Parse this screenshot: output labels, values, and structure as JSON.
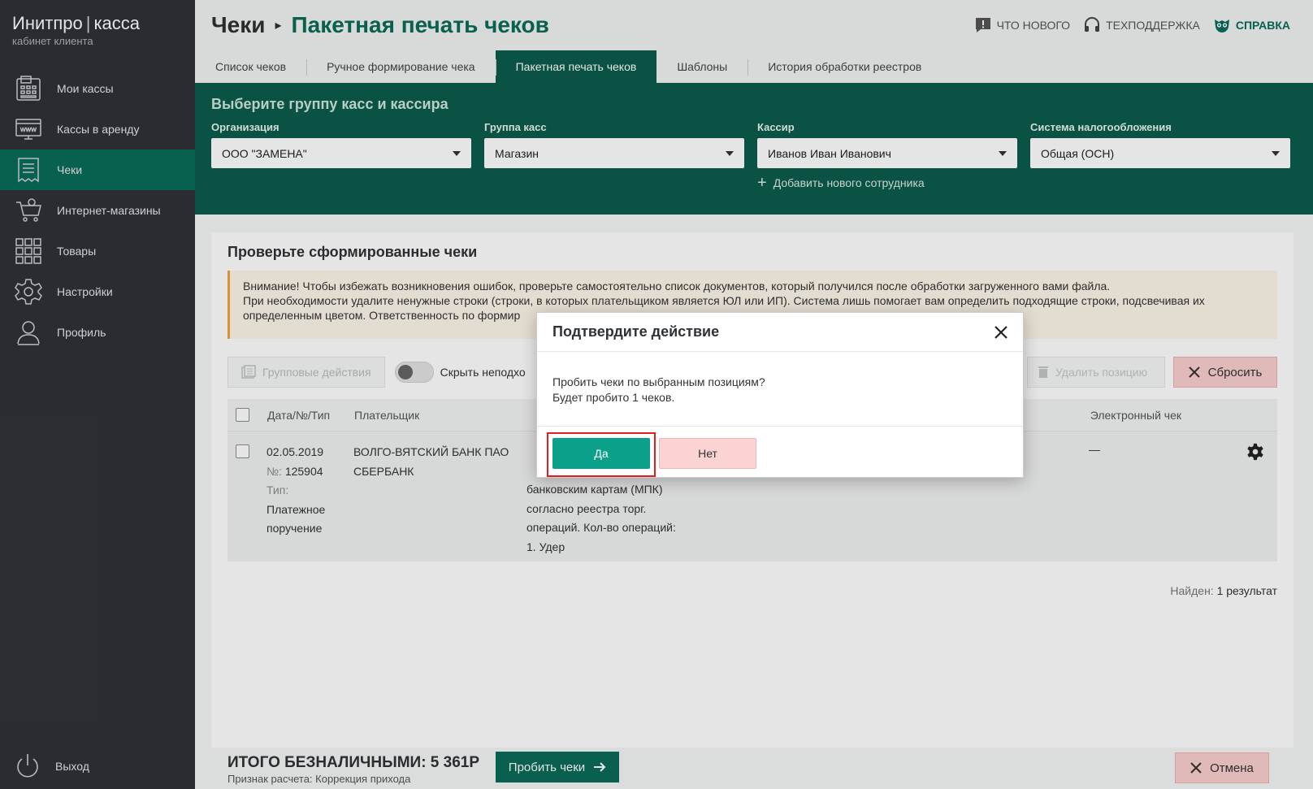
{
  "brand": {
    "name": "Инитпро",
    "product": "касса",
    "subtitle": "кабинет клиента"
  },
  "sidebar": {
    "items": [
      {
        "label": "Мои кассы",
        "icon": "cash-register-icon"
      },
      {
        "label": "Кассы в аренду",
        "icon": "www-icon"
      },
      {
        "label": "Чеки",
        "icon": "receipt-icon",
        "active": true
      },
      {
        "label": "Интернет-магазины",
        "icon": "cart-icon"
      },
      {
        "label": "Товары",
        "icon": "grid-icon"
      },
      {
        "label": "Настройки",
        "icon": "gear-icon"
      },
      {
        "label": "Профиль",
        "icon": "user-icon"
      }
    ],
    "logout": "Выход"
  },
  "header": {
    "root": "Чеки",
    "page": "Пакетная печать чеков",
    "links": {
      "whats_new": "ЧТО НОВОГО",
      "support": "ТЕХПОДДЕРЖКА",
      "help": "СПРАВКА"
    }
  },
  "tabs": [
    "Список чеков",
    "Ручное формирование чека",
    "Пакетная печать чеков",
    "Шаблоны",
    "История обработки реестров"
  ],
  "filters": {
    "title": "Выберите группу касс и кассира",
    "org_label": "Организация",
    "org_value": "ООО \"ЗАМЕНА\"",
    "group_label": "Группа касс",
    "group_value": "Магазин",
    "cashier_label": "Кассир",
    "cashier_value": "Иванов Иван Иванович",
    "tax_label": "Система налогообложения",
    "tax_value": "Общая (ОСН)",
    "add_employee": "Добавить нового сотрудника"
  },
  "content": {
    "title": "Проверьте сформированные чеки",
    "warning_1": "Внимание! Чтобы избежать возникновения ошибок, проверьте самостоятельно список документов, который получился после обработки загруженного вами файла.",
    "warning_2": "При необходимости удалите ненужные строки (строки, в которых плательщиком является ЮЛ или ИП). Система лишь помогает вам определить подходящие строки, подсвечивая их",
    "warning_3": "определенным цветом. Ответственность по формир",
    "group_actions": "Групповые действия",
    "hide_label": "Скрыть неподхо",
    "delete_position": "Удалить позицию",
    "reset": "Сбросить",
    "col_date": "Дата/№/Тип",
    "col_payer": "Плательщик",
    "col_ech": "Электронный чек",
    "row": {
      "date": "02.05.2019",
      "num_label": "№:",
      "num": "125904",
      "type_label": "Тип:",
      "type_1": "Платежное",
      "type_2": "поручение",
      "payer_1": "ВОЛГО-ВЯТСКИЙ БАНК ПАО",
      "payer_2": "СБЕРБАНК",
      "desc_1": "банковским картам (МПК)",
      "desc_2": "согласно реестра торг.",
      "desc_3": "операций. Кол-во операций:",
      "desc_4": "1. Удер",
      "ech": "—"
    },
    "found_label": "Найден:",
    "found_value": "1 результат"
  },
  "footer": {
    "total": "ИТОГО БЕЗНАЛИЧНЫМИ: 5 361Р",
    "sub": "Признак расчета: Коррекция прихода",
    "punch": "Пробить чеки",
    "cancel": "Отмена"
  },
  "modal": {
    "title": "Подтвердите действие",
    "line_1": "Пробить чеки по выбранным позициям?",
    "line_2": "Будет пробито 1 чеков.",
    "yes": "Да",
    "no": "Нет"
  }
}
